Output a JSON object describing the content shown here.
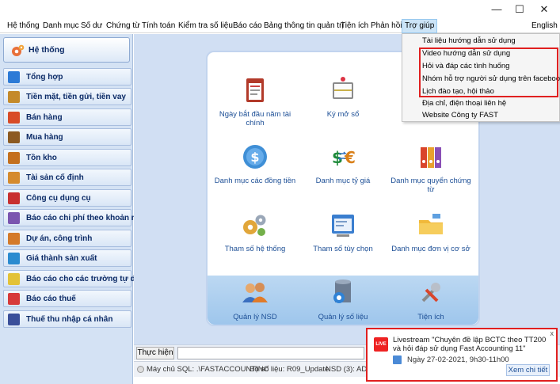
{
  "window": {
    "minimize": "—",
    "maximize": "☐",
    "close": "✕"
  },
  "menubar": {
    "items": [
      "Hệ thống",
      "Danh mục",
      "Số dư",
      "Chứng từ",
      "Tính toán",
      "Kiểm tra số liệu",
      "Báo cáo",
      "Bảng thông tin quản trị",
      "Tiện ích",
      "Phản hồi",
      "Trợ giúp"
    ],
    "language": "English"
  },
  "help_menu": {
    "items": [
      "Tài liệu hướng dẫn sử dụng",
      "Video hướng dẫn sử dụng",
      "Hỏi và đáp các tình huống",
      "Nhóm hỗ trợ người sử dụng trên facebook",
      "Lịch đào tạo, hội thảo",
      "Địa chỉ, điện thoại liên hệ",
      "Website Công ty FAST"
    ]
  },
  "sidebar": {
    "header": "Hệ thống",
    "items": [
      "Tổng hợp",
      "Tiền mặt, tiền gửi, tiền vay",
      "Bán hàng",
      "Mua hàng",
      "Tồn kho",
      "Tài sản cố định",
      "Công cụ dụng cụ",
      "Báo cáo chi phí theo khoản mục",
      "Dự án, công trình",
      "Giá thành sản xuất",
      "Báo cáo cho các trường tự do",
      "Báo cáo thuế",
      "Thuế thu nhập cá nhân"
    ],
    "colors": [
      "#2c7ad6",
      "#c48a2a",
      "#d84b28",
      "#8c5a22",
      "#c4701e",
      "#d58b2e",
      "#c83030",
      "#7a55b0",
      "#d47a2a",
      "#2a8bd0",
      "#e3c238",
      "#d73a3a",
      "#3a4f9a"
    ]
  },
  "tiles": {
    "row1": [
      "Ngày bắt đầu năm tài chính",
      "Ký mở sổ"
    ],
    "row2": [
      "Danh mục các đồng tiền",
      "Danh mục tỷ giá",
      "Danh mục quyển chứng từ"
    ],
    "row3": [
      "Tham số hệ thống",
      "Tham số tùy chọn",
      "Danh mục đơn vị cơ sở"
    ],
    "row4": [
      "Quản lý NSD",
      "Quản lý số liệu",
      "Tiện ích"
    ]
  },
  "command": {
    "button": "Thực hiện",
    "value": ""
  },
  "status": {
    "server": "Máy chủ SQL: .\\FASTACCOUNTINC",
    "database": "Bộ số liệu: R09_Update",
    "user": "NSD (3): ADM"
  },
  "toast": {
    "close": "x",
    "badge": "LIVE",
    "message": "Livestream \"Chuyên đề lập BCTC theo TT200 và hỏi đáp sử dụng Fast Accounting 11\"",
    "date": "Ngày 27-02-2021, 9h30-11h00",
    "more": "Xem chi tiết"
  }
}
